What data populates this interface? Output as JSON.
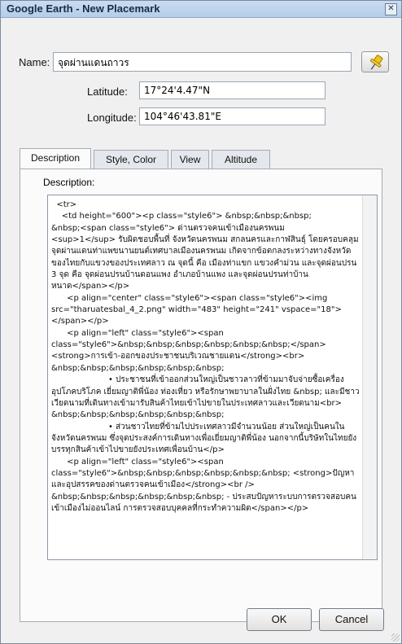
{
  "window": {
    "title": "Google Earth - New Placemark",
    "close_symbol": "✕"
  },
  "name_field": {
    "label": "Name:",
    "value": "จุดผ่านแดนถาวร"
  },
  "latitude": {
    "label": "Latitude:",
    "value": "17°24'4.47\"N"
  },
  "longitude": {
    "label": "Longitude:",
    "value": "104°46'43.81\"E"
  },
  "pin_icon": {
    "color": "#f0c419"
  },
  "tabs": [
    {
      "label": "Description",
      "active": true
    },
    {
      "label": "Style, Color",
      "active": false
    },
    {
      "label": "View",
      "active": false
    },
    {
      "label": "Altitude",
      "active": false
    }
  ],
  "description": {
    "label": "Description:",
    "text": "  <tr>\n    <td height=\"600\"><p class=\"style6\"> &nbsp;&nbsp;&nbsp;\n&nbsp;<span class=\"style6\"> ด่านตรวจคนเข้าเมืองนครพนม\n<sup>1</sup> รับผิดชอบพื้นที่ จังหวัดนครพนม สกลนครและกาฬสินธุ์ โดยครอบคลุมจุดผ่านแดนท่าแพขนานยนต์เทศบาลเมืองนครพนม เกิดจากข้อตกลงระหว่างทางจังหวัดของไทยกับแขวงของประเทศลาว ณ จุดนี้ คือ เมืองท่าแขก แขวงคำม่วน และจุดผ่อนปรน 3 จุด คือ จุดผ่อนปรนบ้านดอนแพง อำเภอบ้านแพง และจุดผ่อนปรนท่าบ้านหนาด</span></p>\n      <p align=\"center\" class=\"style6\"><span class=\"style6\"><img src=\"tharuatesbal_4_2.png\" width=\"483\" height=\"241\" vspace=\"18\"></span></p>\n      <p align=\"left\" class=\"style6\"><span class=\"style6\">&nbsp;&nbsp;&nbsp;&nbsp;&nbsp;&nbsp;</span><strong>การเข้า-ออกของประชาชนบริเวณชายแดน</strong><br>\n&nbsp;&nbsp;&nbsp;&nbsp;&nbsp;&nbsp;\n                      • ประชาชนที่เข้าออกส่วนใหญ่เป็นชาวลาวที่ข้ามมาจับจ่ายซื้อเครื่องอุปโภคบริโภค เยี่ยมญาติพี่น้อง ท่องเที่ยว หรือรักษาพยาบาลในฝั่งไทย &nbsp; และมีชาวเวียดนามที่เดินทางเข้ามารับสินค้าไทยเข้าไปขายในประเทศลาวและเวียดนาม<br>\n&nbsp;&nbsp;&nbsp;&nbsp;&nbsp;&nbsp;\n                      • ส่วนชาวไทยที่ข้ามไปประเทศลาวมีจำนวนน้อย ส่วนใหญ่เป็นคนในจังหวัดนครพนม ซึ่งจุดประสงค์การเดินทางเพื่อเยี่ยมญาติพี่น้อง นอกจากนี้บริษัทในไทยยังบรรทุกสินค้าเข้าไปขายยังประเทศเพื่อนบ้าน</p>\n      <p align=\"left\" class=\"style6\"><span class=\"style6\">&nbsp;&nbsp;&nbsp;&nbsp;&nbsp;&nbsp; <strong>ปัญหาและอุปสรรคของด่านตรวจคนเข้าเมือง</strong><br />\n&nbsp;&nbsp;&nbsp;&nbsp;&nbsp;&nbsp; - ประสบปัญหาระบบการตรวจสอบคนเข้าเมืองไม่ออนไลน์ การตรวจสอบบุคคลที่กระทำความผิด</span></p>"
  },
  "buttons": {
    "ok": "OK",
    "cancel": "Cancel"
  }
}
